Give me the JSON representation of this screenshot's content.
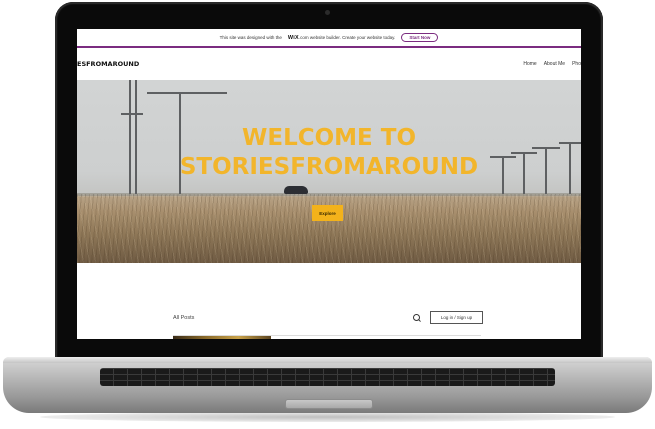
{
  "wix_banner": {
    "text_before": "This site was designed with the",
    "brand": "WiX",
    "text_after": ".com website builder. Create your website today.",
    "cta": "Start Now"
  },
  "site": {
    "logo": "ESFROMAROUND",
    "nav": [
      "Home",
      "About Me",
      "Pho"
    ]
  },
  "hero": {
    "title_line1": "WELCOME TO",
    "title_line2": "STORIESFROMAROUND",
    "cta": "Explore"
  },
  "blog": {
    "heading": "All Posts",
    "login": "Log in / Sign up"
  },
  "colors": {
    "accent": "#f3b21b",
    "wix_purple": "#7b2c80"
  }
}
